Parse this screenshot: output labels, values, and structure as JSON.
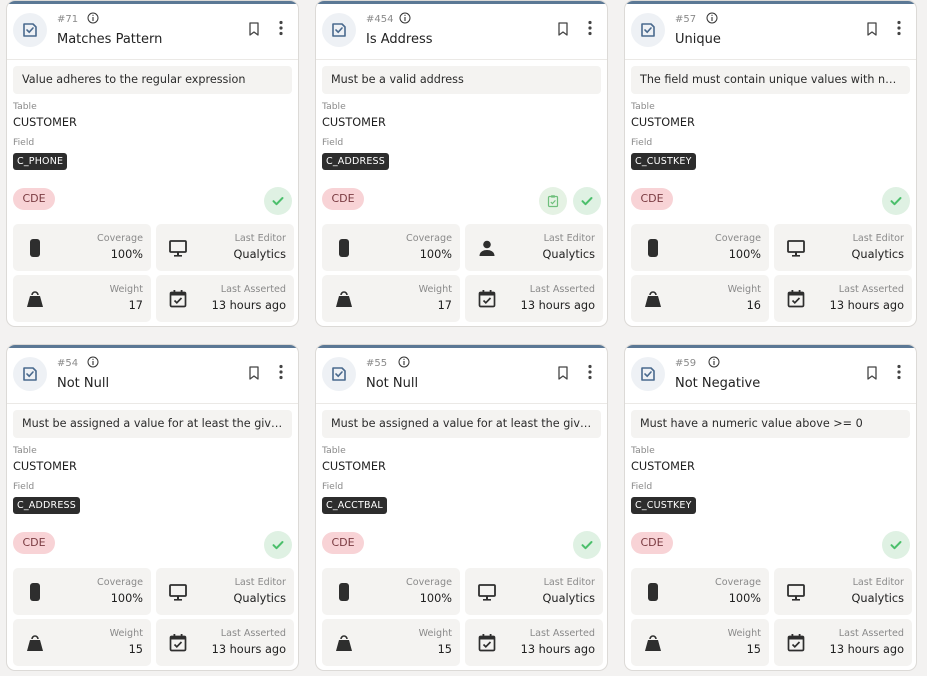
{
  "labels": {
    "table": "Table",
    "field": "Field",
    "coverage": "Coverage",
    "last_editor": "Last Editor",
    "weight": "Weight",
    "last_asserted": "Last Asserted"
  },
  "colors": {
    "accent_top": "#5b7895",
    "cde_bg": "#f8d3d6",
    "check_green": "#4bbf6b"
  },
  "cards": [
    {
      "id": "#71",
      "name": "Matches Pattern",
      "description": "Value adheres to the regular expression",
      "table": "CUSTOMER",
      "field": "C_PHONE",
      "tag": "CDE",
      "coverage": "100%",
      "last_editor": "Qualytics",
      "editor_icon": "monitor-icon",
      "weight": "17",
      "last_asserted": "13 hours ago",
      "has_clipboard_status": false
    },
    {
      "id": "#454",
      "name": "Is Address",
      "description": "Must be a valid address",
      "table": "CUSTOMER",
      "field": "C_ADDRESS",
      "tag": "CDE",
      "coverage": "100%",
      "last_editor": "Qualytics",
      "editor_icon": "person-icon",
      "weight": "17",
      "last_asserted": "13 hours ago",
      "has_clipboard_status": true
    },
    {
      "id": "#57",
      "name": "Unique",
      "description": "The field must contain unique values with no ...",
      "table": "CUSTOMER",
      "field": "C_CUSTKEY",
      "tag": "CDE",
      "coverage": "100%",
      "last_editor": "Qualytics",
      "editor_icon": "monitor-icon",
      "weight": "16",
      "last_asserted": "13 hours ago",
      "has_clipboard_status": false
    },
    {
      "id": "#54",
      "name": "Not Null",
      "description": "Must be assigned a value for at least the give...",
      "table": "CUSTOMER",
      "field": "C_ADDRESS",
      "tag": "CDE",
      "coverage": "100%",
      "last_editor": "Qualytics",
      "editor_icon": "monitor-icon",
      "weight": "15",
      "last_asserted": "13 hours ago",
      "has_clipboard_status": false
    },
    {
      "id": "#55",
      "name": "Not Null",
      "description": "Must be assigned a value for at least the give...",
      "table": "CUSTOMER",
      "field": "C_ACCTBAL",
      "tag": "CDE",
      "coverage": "100%",
      "last_editor": "Qualytics",
      "editor_icon": "monitor-icon",
      "weight": "15",
      "last_asserted": "13 hours ago",
      "has_clipboard_status": false
    },
    {
      "id": "#59",
      "name": "Not Negative",
      "description": "Must have a numeric value above >= 0",
      "table": "CUSTOMER",
      "field": "C_CUSTKEY",
      "tag": "CDE",
      "coverage": "100%",
      "last_editor": "Qualytics",
      "editor_icon": "monitor-icon",
      "weight": "15",
      "last_asserted": "13 hours ago",
      "has_clipboard_status": false
    }
  ]
}
